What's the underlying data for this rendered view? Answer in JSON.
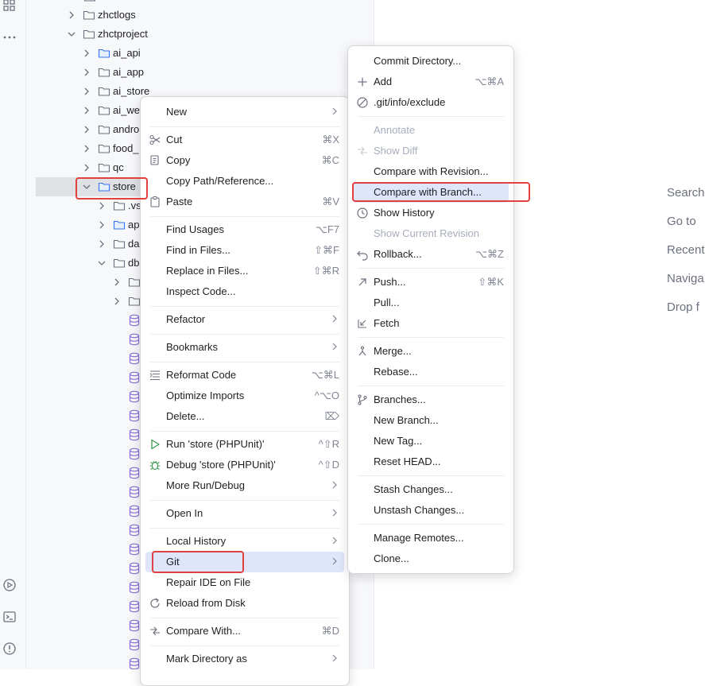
{
  "project_tree": {
    "items": [
      {
        "label": "zhctlogs",
        "depth": 1,
        "expanded": false
      },
      {
        "label": "zhctproject",
        "depth": 1,
        "expanded": true
      },
      {
        "label": "ai_api",
        "depth": 2,
        "expanded": false
      },
      {
        "label": "ai_app",
        "depth": 2,
        "expanded": false
      },
      {
        "label": "ai_store",
        "depth": 2,
        "expanded": false
      },
      {
        "label": "ai_we",
        "depth": 2,
        "expanded": false
      },
      {
        "label": "andro",
        "depth": 2,
        "expanded": false
      },
      {
        "label": "food_",
        "depth": 2,
        "expanded": false
      },
      {
        "label": "qc",
        "depth": 2,
        "expanded": false
      },
      {
        "label": "store",
        "depth": 2,
        "expanded": true,
        "selected": true
      },
      {
        "label": ".vs",
        "depth": 3,
        "expanded": false
      },
      {
        "label": "ap",
        "depth": 3,
        "expanded": false
      },
      {
        "label": "da",
        "depth": 3,
        "expanded": false
      },
      {
        "label": "db",
        "depth": 3,
        "expanded": true
      }
    ]
  },
  "editor_hints": [
    "Search",
    "Go to",
    "Recent",
    "Naviga",
    "Drop f"
  ],
  "context_menu": {
    "items": [
      {
        "label": "New",
        "submenu": true
      },
      {
        "label": "Cut",
        "shortcut": "⌘X",
        "icon": "scissors-icon"
      },
      {
        "label": "Copy",
        "shortcut": "⌘C",
        "icon": "copy-icon"
      },
      {
        "label": "Copy Path/Reference..."
      },
      {
        "label": "Paste",
        "shortcut": "⌘V",
        "icon": "paste-icon"
      },
      {
        "label": "Find Usages",
        "shortcut": "⌥F7"
      },
      {
        "label": "Find in Files...",
        "shortcut": "⇧⌘F"
      },
      {
        "label": "Replace in Files...",
        "shortcut": "⇧⌘R"
      },
      {
        "label": "Inspect Code..."
      },
      {
        "label": "Refactor",
        "submenu": true
      },
      {
        "label": "Bookmarks",
        "submenu": true
      },
      {
        "label": "Reformat Code",
        "shortcut": "⌥⌘L",
        "icon": "reformat-icon"
      },
      {
        "label": "Optimize Imports",
        "shortcut": "^⌥O"
      },
      {
        "label": "Delete...",
        "shortcut": "⌦"
      },
      {
        "label": "Run 'store (PHPUnit)'",
        "shortcut": "^⇧R",
        "icon": "run-icon"
      },
      {
        "label": "Debug 'store (PHPUnit)'",
        "shortcut": "^⇧D",
        "icon": "debug-icon"
      },
      {
        "label": "More Run/Debug",
        "submenu": true
      },
      {
        "label": "Open In",
        "submenu": true
      },
      {
        "label": "Local History",
        "submenu": true
      },
      {
        "label": "Git",
        "submenu": true,
        "active": true
      },
      {
        "label": "Repair IDE on File"
      },
      {
        "label": "Reload from Disk",
        "icon": "reload-icon"
      },
      {
        "label": "Compare With...",
        "shortcut": "⌘D",
        "icon": "compare-icon"
      },
      {
        "label": "Mark Directory as",
        "submenu": true
      }
    ]
  },
  "git_menu": {
    "items": [
      {
        "label": "Commit Directory..."
      },
      {
        "label": "Add",
        "shortcut": "⌥⌘A",
        "icon": "plus-icon"
      },
      {
        "label": ".git/info/exclude",
        "icon": "ignore-icon"
      },
      {
        "label": "Annotate",
        "disabled": true
      },
      {
        "label": "Show Diff",
        "disabled": true,
        "icon": "diff-icon"
      },
      {
        "label": "Compare with Revision..."
      },
      {
        "label": "Compare with Branch...",
        "highlighted": true
      },
      {
        "label": "Show History",
        "icon": "clock-icon"
      },
      {
        "label": "Show Current Revision",
        "disabled": true
      },
      {
        "label": "Rollback...",
        "shortcut": "⌥⌘Z",
        "icon": "rollback-icon"
      },
      {
        "label": "Push...",
        "shortcut": "⇧⌘K",
        "icon": "push-icon"
      },
      {
        "label": "Pull..."
      },
      {
        "label": "Fetch",
        "icon": "fetch-icon"
      },
      {
        "label": "Merge...",
        "icon": "merge-icon"
      },
      {
        "label": "Rebase..."
      },
      {
        "label": "Branches...",
        "icon": "branch-icon"
      },
      {
        "label": "New Branch..."
      },
      {
        "label": "New Tag..."
      },
      {
        "label": "Reset HEAD..."
      },
      {
        "label": "Stash Changes..."
      },
      {
        "label": "Unstash Changes..."
      },
      {
        "label": "Manage Remotes..."
      },
      {
        "label": "Clone..."
      }
    ]
  },
  "colors": {
    "highlight": "#dfe6fb",
    "callout": "#e0413f",
    "folder": "#3574f0",
    "database": "#8c6dd9"
  }
}
